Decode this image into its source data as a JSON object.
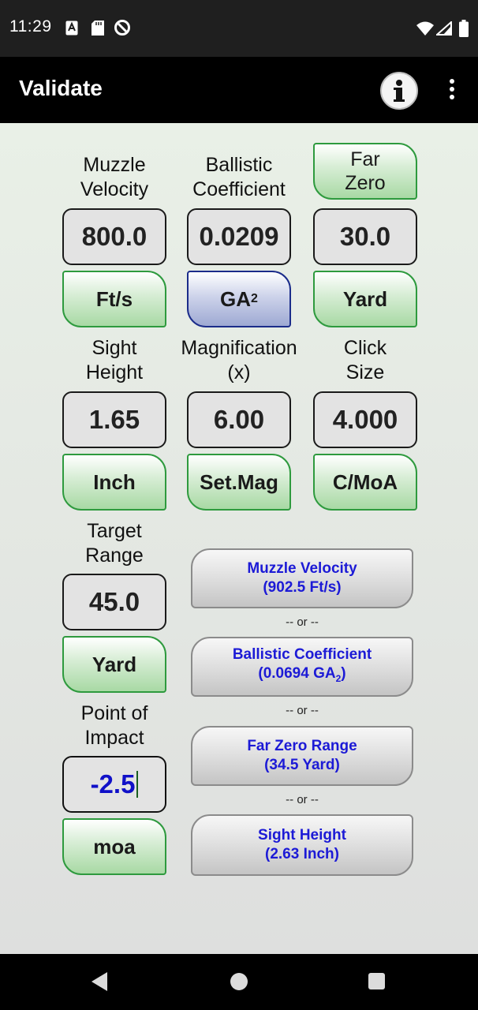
{
  "status_bar": {
    "time": "11:29"
  },
  "app_bar": {
    "title": "Validate"
  },
  "inputs": {
    "muzzle_velocity": {
      "label_line1": "Muzzle",
      "label_line2": "Velocity",
      "value": "800.0",
      "unit": "Ft/s"
    },
    "ballistic_coefficient": {
      "label_line1": "Ballistic",
      "label_line2": "Coefficient",
      "value": "0.0209",
      "unit_base": "GA",
      "unit_sub": "2"
    },
    "far_zero": {
      "button_line1": "Far",
      "button_line2": "Zero",
      "value": "30.0",
      "unit": "Yard"
    },
    "sight_height": {
      "label_line1": "Sight",
      "label_line2": "Height",
      "value": "1.65",
      "unit": "Inch"
    },
    "magnification": {
      "label_line1": "Magnification",
      "label_line2": "(x)",
      "value": "6.00",
      "unit": "Set.Mag"
    },
    "click_size": {
      "label_line1": "Click",
      "label_line2": "Size",
      "value": "4.000",
      "unit": "C/MoA"
    },
    "target_range": {
      "label_line1": "Target",
      "label_line2": "Range",
      "value": "45.0",
      "unit": "Yard"
    },
    "point_of_impact": {
      "label_line1": "Point of",
      "label_line2": "Impact",
      "value": "-2.5",
      "unit": "moa"
    }
  },
  "results": {
    "muzzle_velocity": {
      "line1": "Muzzle Velocity",
      "line2": "(902.5 Ft/s)"
    },
    "ballistic_coefficient": {
      "line1": "Ballistic Coefficient",
      "line2_prefix": "(0.0694 GA",
      "line2_sub": "2",
      "line2_suffix": ")"
    },
    "far_zero_range": {
      "line1": "Far Zero Range",
      "line2": "(34.5 Yard)"
    },
    "sight_height": {
      "line1": "Sight Height",
      "line2": "(2.63 Inch)"
    },
    "separator": "-- or --"
  },
  "colors": {
    "green_button": "#a8d9a4",
    "blue_button": "#9ea9d3",
    "result_text": "#1c1ad6",
    "active_value": "#1010c8"
  }
}
